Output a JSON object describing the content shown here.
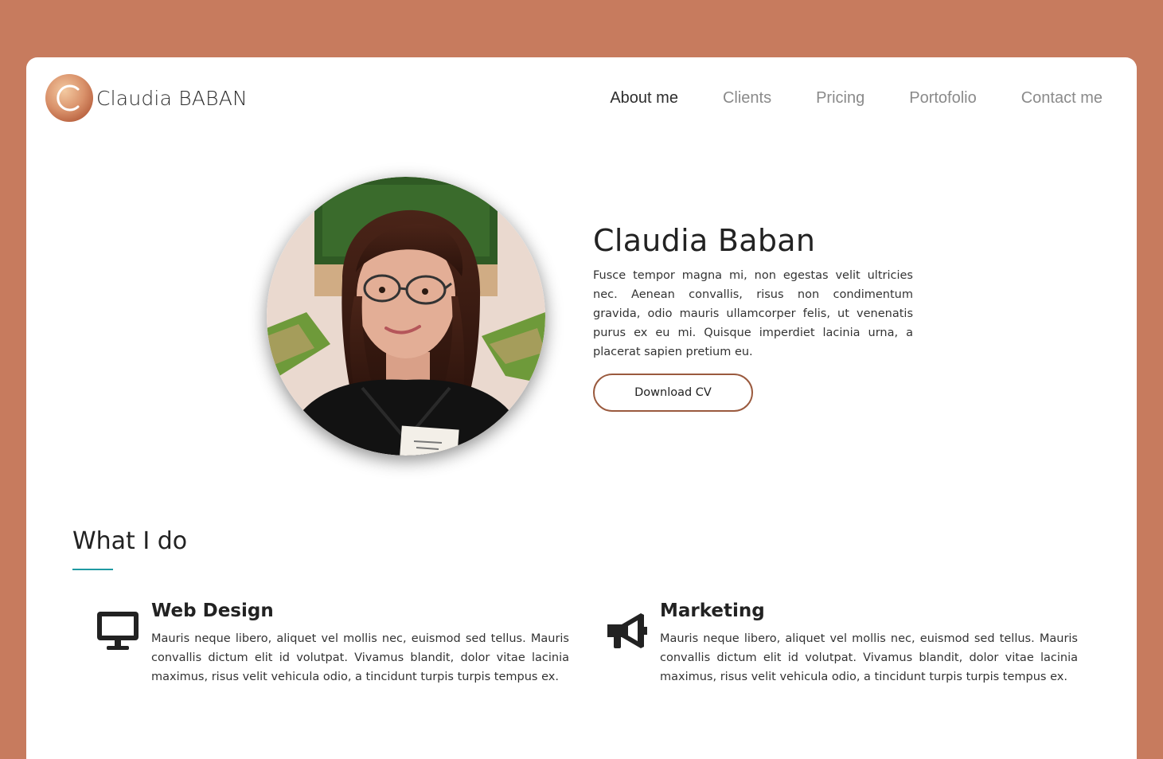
{
  "header": {
    "logo_text": "Claudia BABAN",
    "nav": [
      {
        "label": "About me",
        "active": true
      },
      {
        "label": "Clients",
        "active": false
      },
      {
        "label": "Pricing",
        "active": false
      },
      {
        "label": "Portofolio",
        "active": false
      },
      {
        "label": "Contact me",
        "active": false
      }
    ]
  },
  "hero": {
    "name": "Claudia Baban",
    "description": "Fusce tempor magna mi, non egestas velit ultricies nec. Aenean convallis, risus non condimentum gravida, odio mauris ullamcorper felis, ut venenatis purus ex eu mi. Quisque imperdiet lacinia urna, a placerat sapien pretium eu.",
    "button_label": "Download CV",
    "portrait_icon": "portrait-photo"
  },
  "services": {
    "title": "What I do",
    "items": [
      {
        "icon": "desktop-icon",
        "title": "Web Design",
        "text": "Mauris neque libero, aliquet vel mollis nec, euismod sed tellus. Mauris convallis dictum elit id volutpat. Vivamus blandit, dolor vitae lacinia maximus, risus velit vehicula odio, a tincidunt turpis turpis tempus ex."
      },
      {
        "icon": "megaphone-icon",
        "title": "Marketing",
        "text": "Mauris neque libero, aliquet vel mollis nec, euismod sed tellus. Mauris convallis dictum elit id volutpat. Vivamus blandit, dolor vitae lacinia maximus, risus velit vehicula odio, a tincidunt turpis turpis tempus ex."
      }
    ]
  },
  "colors": {
    "background": "#c77b5e",
    "accent": "#9a5a3e",
    "underline": "#1f9aa2"
  }
}
